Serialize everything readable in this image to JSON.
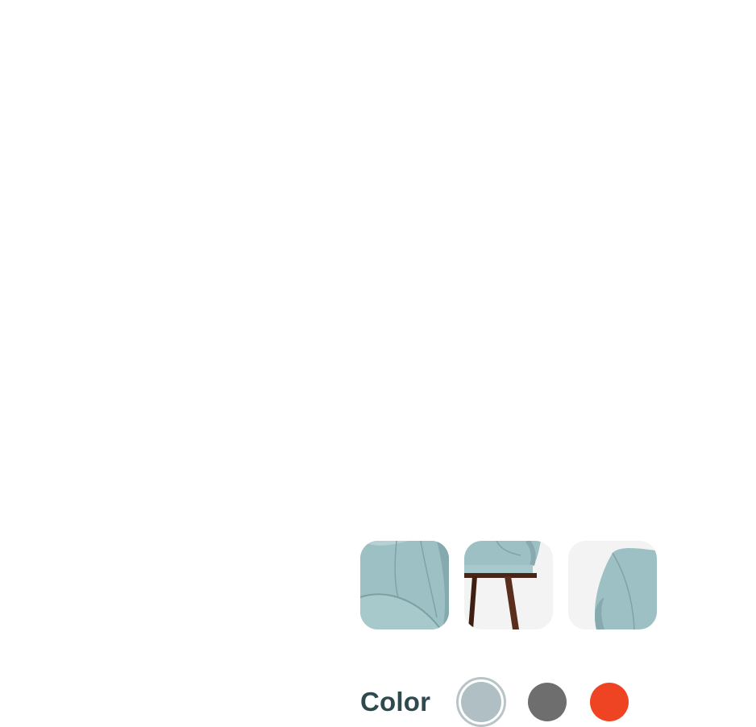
{
  "color_section": {
    "label": "Color",
    "swatches": [
      {
        "name": "light-blue",
        "hex": "#afbfc4",
        "selected": true
      },
      {
        "name": "gray",
        "hex": "#6e6e6e",
        "selected": false
      },
      {
        "name": "orange-red",
        "hex": "#ee4423",
        "selected": false
      }
    ]
  },
  "thumbnails": [
    {
      "name": "chair-seat-closeup"
    },
    {
      "name": "chair-side-leg-view"
    },
    {
      "name": "chair-arm-closeup"
    }
  ],
  "colors": {
    "fabric": "#9fc0c3",
    "wood": "#5a2e1c",
    "label_text": "#2f4a4e"
  }
}
